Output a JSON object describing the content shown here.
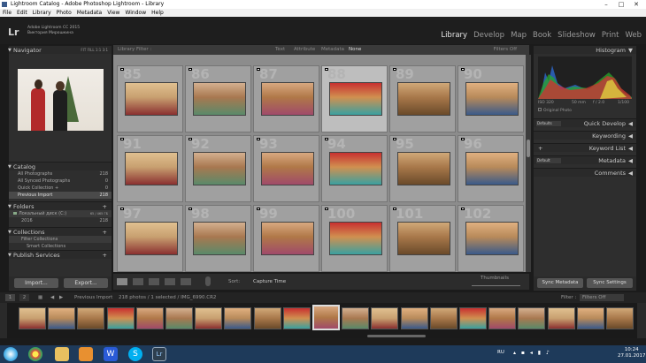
{
  "window": {
    "title": "Lightroom Catalog - Adobe Photoshop Lightroom - Library"
  },
  "menu": [
    "File",
    "Edit",
    "Library",
    "Photo",
    "Metadata",
    "View",
    "Window",
    "Help"
  ],
  "identity": {
    "app": "Adobe Lightroom CC 2015",
    "user": "Виктория Мирошкина",
    "logo": "Lr"
  },
  "modules": [
    "Library",
    "Develop",
    "Map",
    "Book",
    "Slideshow",
    "Print",
    "Web"
  ],
  "navigator": {
    "title": "Navigator",
    "zoom": [
      "FIT",
      "FILL",
      "1:1",
      "3:1"
    ]
  },
  "catalog": {
    "title": "Catalog",
    "items": [
      {
        "label": "All Photographs",
        "count": "218"
      },
      {
        "label": "All Synced Photographs",
        "count": "0"
      },
      {
        "label": "Quick Collection +",
        "count": "0"
      },
      {
        "label": "Previous Import",
        "count": "218"
      }
    ]
  },
  "folders": {
    "title": "Folders",
    "disk": "Локальный диск (C:)",
    "disk_size": "65 / 465 ГБ",
    "items": [
      {
        "label": "2016",
        "count": "218"
      }
    ]
  },
  "collections": {
    "title": "Collections",
    "items": [
      "Filter Collections",
      "Smart Collections"
    ]
  },
  "publish": {
    "title": "Publish Services"
  },
  "buttons": {
    "import": "Import...",
    "export": "Export...",
    "sync_metadata": "Sync Metadata",
    "sync_settings": "Sync Settings"
  },
  "filterbar": {
    "label": "Library Filter :",
    "options": [
      "Text",
      "Attribute",
      "Metadata",
      "None"
    ],
    "filters_off": "Filters Off"
  },
  "grid": {
    "numbers": [
      "85",
      "86",
      "87",
      "88",
      "89",
      "90",
      "91",
      "92",
      "93",
      "94",
      "95",
      "96",
      "97",
      "98",
      "99",
      "100",
      "101",
      "102"
    ],
    "selected_index": 3
  },
  "toolbar": {
    "sort_label": "Sort:",
    "sort_value": "Capture Time",
    "thumbnails": "Thumbnails"
  },
  "histogram": {
    "title": "Histogram",
    "iso": "ISO 320",
    "focal": "50 mm",
    "aperture": "f / 2.0",
    "shutter": "1/100",
    "original": "Original Photo"
  },
  "right_panels": [
    "Quick Develop",
    "Keywording",
    "Keyword List",
    "Metadata",
    "Comments"
  ],
  "right_presets": {
    "qd": "Defaults",
    "meta": "Default"
  },
  "filmstrip": {
    "source": "Previous Import",
    "count_text": "218 photos / 1 selected / IMG_6990.CR2",
    "filter_label": "Filter :",
    "filter_value": "Filters Off",
    "pages": [
      "1",
      "2"
    ]
  },
  "taskbar": {
    "lang": "RU",
    "time": "10:24",
    "date": "27.01.2017"
  }
}
